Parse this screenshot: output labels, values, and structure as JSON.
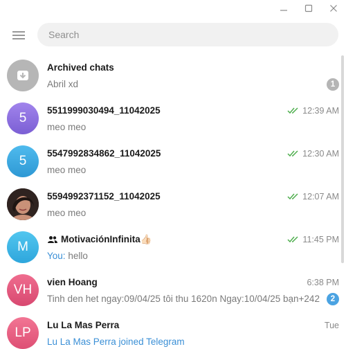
{
  "window": {
    "controls": [
      "minimize",
      "maximize",
      "close"
    ]
  },
  "search": {
    "placeholder": "Search"
  },
  "icons": {
    "menu": "hamburger-menu-icon",
    "archive": "archive-box-icon",
    "read": "double-check-icon",
    "group": "group-people-icon"
  },
  "colors": {
    "accent": "#3a8fd6",
    "read_check": "#4fae4e",
    "unread_badge": "#4ba3e2",
    "muted_badge": "#b5b5b5"
  },
  "chats": [
    {
      "name": "Archived chats",
      "message": "Abril xd",
      "time": "",
      "badge": "1",
      "avatar_text": "",
      "avatar_color": "#b6b6b6"
    },
    {
      "name": "5511999030494_11042025",
      "message": "meo meo",
      "time": "12:39 AM",
      "avatar_text": "5",
      "avatar_color": "#8e6fe0"
    },
    {
      "name": "5547992834862_11042025",
      "message": "meo meo",
      "time": "12:30 AM",
      "avatar_text": "5",
      "avatar_color": "#3aa6df"
    },
    {
      "name": "5594992371152_11042025",
      "message": "meo meo",
      "time": "12:07 AM",
      "avatar_text": "",
      "avatar_color": "#7a4a3a"
    },
    {
      "name": "MotivaciónInfinita👍🏻",
      "message_prefix": "You:",
      "message": "hello",
      "time": "11:45 PM",
      "avatar_text": "M",
      "avatar_color": "#3ab5e6"
    },
    {
      "name": "vien Hoang",
      "message": "Tinh den het ngay:09/04/25 tôi thu 1620n Ngay:10/04/25 bạn+242...",
      "time": "6:38 PM",
      "badge": "2",
      "avatar_text": "VH",
      "avatar_color": "#e0507a"
    },
    {
      "name": "Lu La Mas Perra",
      "message": "Lu La Mas Perra joined Telegram",
      "time": "Tue",
      "avatar_text": "LP",
      "avatar_color": "#e85a7a"
    }
  ]
}
